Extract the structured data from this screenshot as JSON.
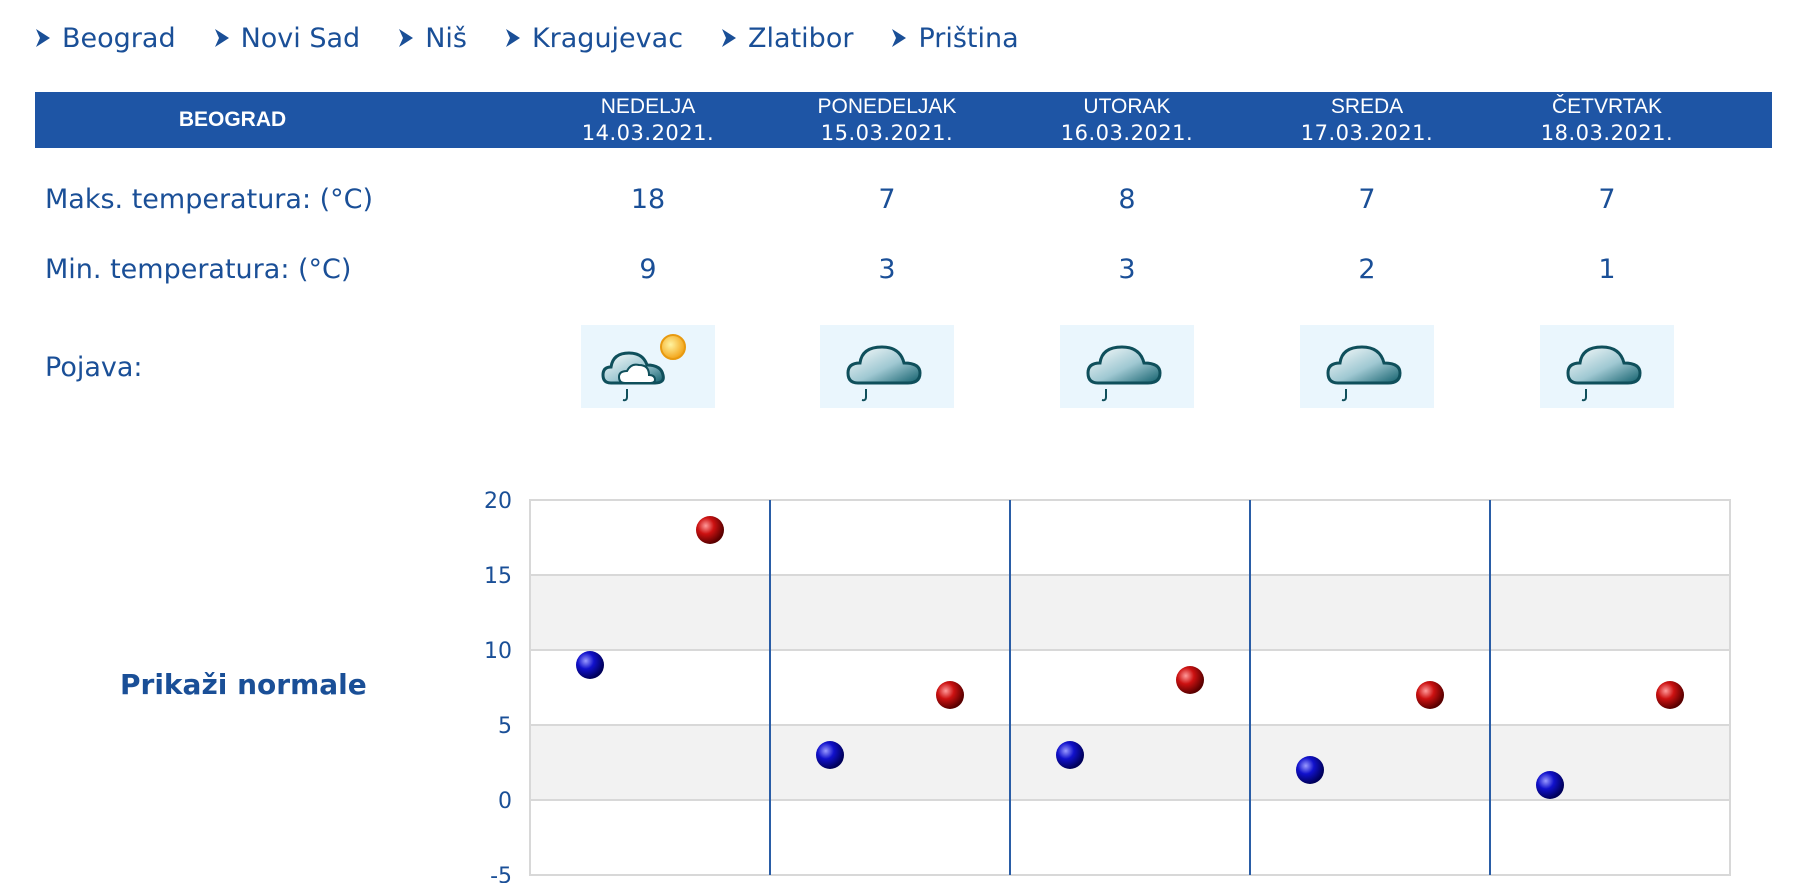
{
  "nav": {
    "cities": [
      "Beograd",
      "Novi Sad",
      "Niš",
      "Kragujevac",
      "Zlatibor",
      "Priština"
    ]
  },
  "forecast": {
    "city": "BEOGRAD",
    "days": [
      {
        "name": "NEDELJA",
        "date": "14.03.2021.",
        "max": "18",
        "min": "9",
        "icon": "partly-cloudy-sun-light-rain-icon"
      },
      {
        "name": "PONEDELJAK",
        "date": "15.03.2021.",
        "max": "7",
        "min": "3",
        "icon": "cloud-light-rain-icon"
      },
      {
        "name": "UTORAK",
        "date": "16.03.2021.",
        "max": "8",
        "min": "3",
        "icon": "cloud-light-rain-icon"
      },
      {
        "name": "SREDA",
        "date": "17.03.2021.",
        "max": "7",
        "min": "2",
        "icon": "cloud-light-rain-icon"
      },
      {
        "name": "ČETVRTAK",
        "date": "18.03.2021.",
        "max": "7",
        "min": "1",
        "icon": "cloud-light-rain-icon"
      }
    ],
    "labels": {
      "max": "Maks. temperatura: (°C)",
      "min": "Min. temperatura: (°C)",
      "phenomenon": "Pojava:"
    }
  },
  "normals_link": "Prikaži normale",
  "colors": {
    "header_bg": "#1e55a5",
    "text": "#1a4f97",
    "max_marker": "#cc1111",
    "min_marker": "#1111cc"
  },
  "chart_data": {
    "type": "scatter",
    "categories": [
      "14.03.2021.",
      "15.03.2021.",
      "16.03.2021.",
      "17.03.2021.",
      "18.03.2021."
    ],
    "series": [
      {
        "values": [
          9,
          3,
          3,
          2,
          1
        ]
      },
      {
        "values": [
          18,
          7,
          8,
          7,
          7
        ]
      }
    ],
    "ylim": [
      -5,
      20
    ],
    "yticks": [
      "20",
      "15",
      "10",
      "5",
      "0",
      "-5"
    ],
    "grid": true,
    "legend": "none"
  }
}
